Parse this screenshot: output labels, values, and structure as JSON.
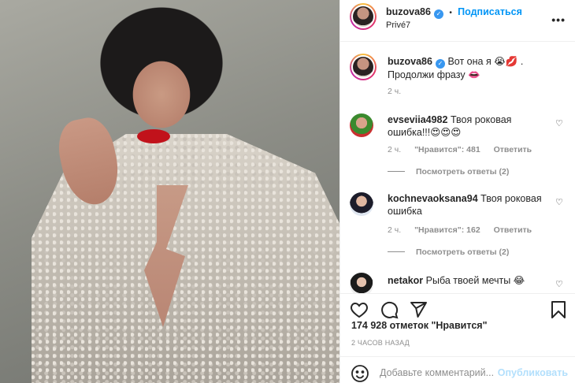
{
  "header": {
    "username": "buzova86",
    "separator": "•",
    "follow_label": "Подписаться",
    "location": "Privé7",
    "more": "•••"
  },
  "caption": {
    "username": "buzova86",
    "text": "Вот она я 😭💋 . Продолжи фразу 👄",
    "time": "2 ч."
  },
  "comments": [
    {
      "username": "evseviia4982",
      "text": "Твоя роковая ошибка!!!😍😍😍",
      "time": "2 ч.",
      "likes": "\"Нравится\": 481",
      "reply": "Ответить",
      "view_replies": "Посмотреть ответы (2)"
    },
    {
      "username": "kochnevaoksana94",
      "text": "Твоя роковая ошибка",
      "time": "2 ч.",
      "likes": "\"Нравится\": 162",
      "reply": "Ответить",
      "view_replies": "Посмотреть ответы (2)"
    },
    {
      "username": "netakor",
      "text": "Рыба твоей мечты 😂"
    }
  ],
  "actions": {
    "like_icon": "heart-icon",
    "comment_icon": "comment-icon",
    "share_icon": "share-icon",
    "save_icon": "bookmark-icon"
  },
  "likes_text": "174 928 отметок \"Нравится\"",
  "timestamp": "2 ЧАСОВ НАЗАД",
  "add_comment": {
    "placeholder": "Добавьте комментарий...",
    "post_label": "Опубликовать"
  },
  "colors": {
    "accent": "#0095f6",
    "verified": "#3897f0",
    "muted": "#8e8e8e"
  }
}
